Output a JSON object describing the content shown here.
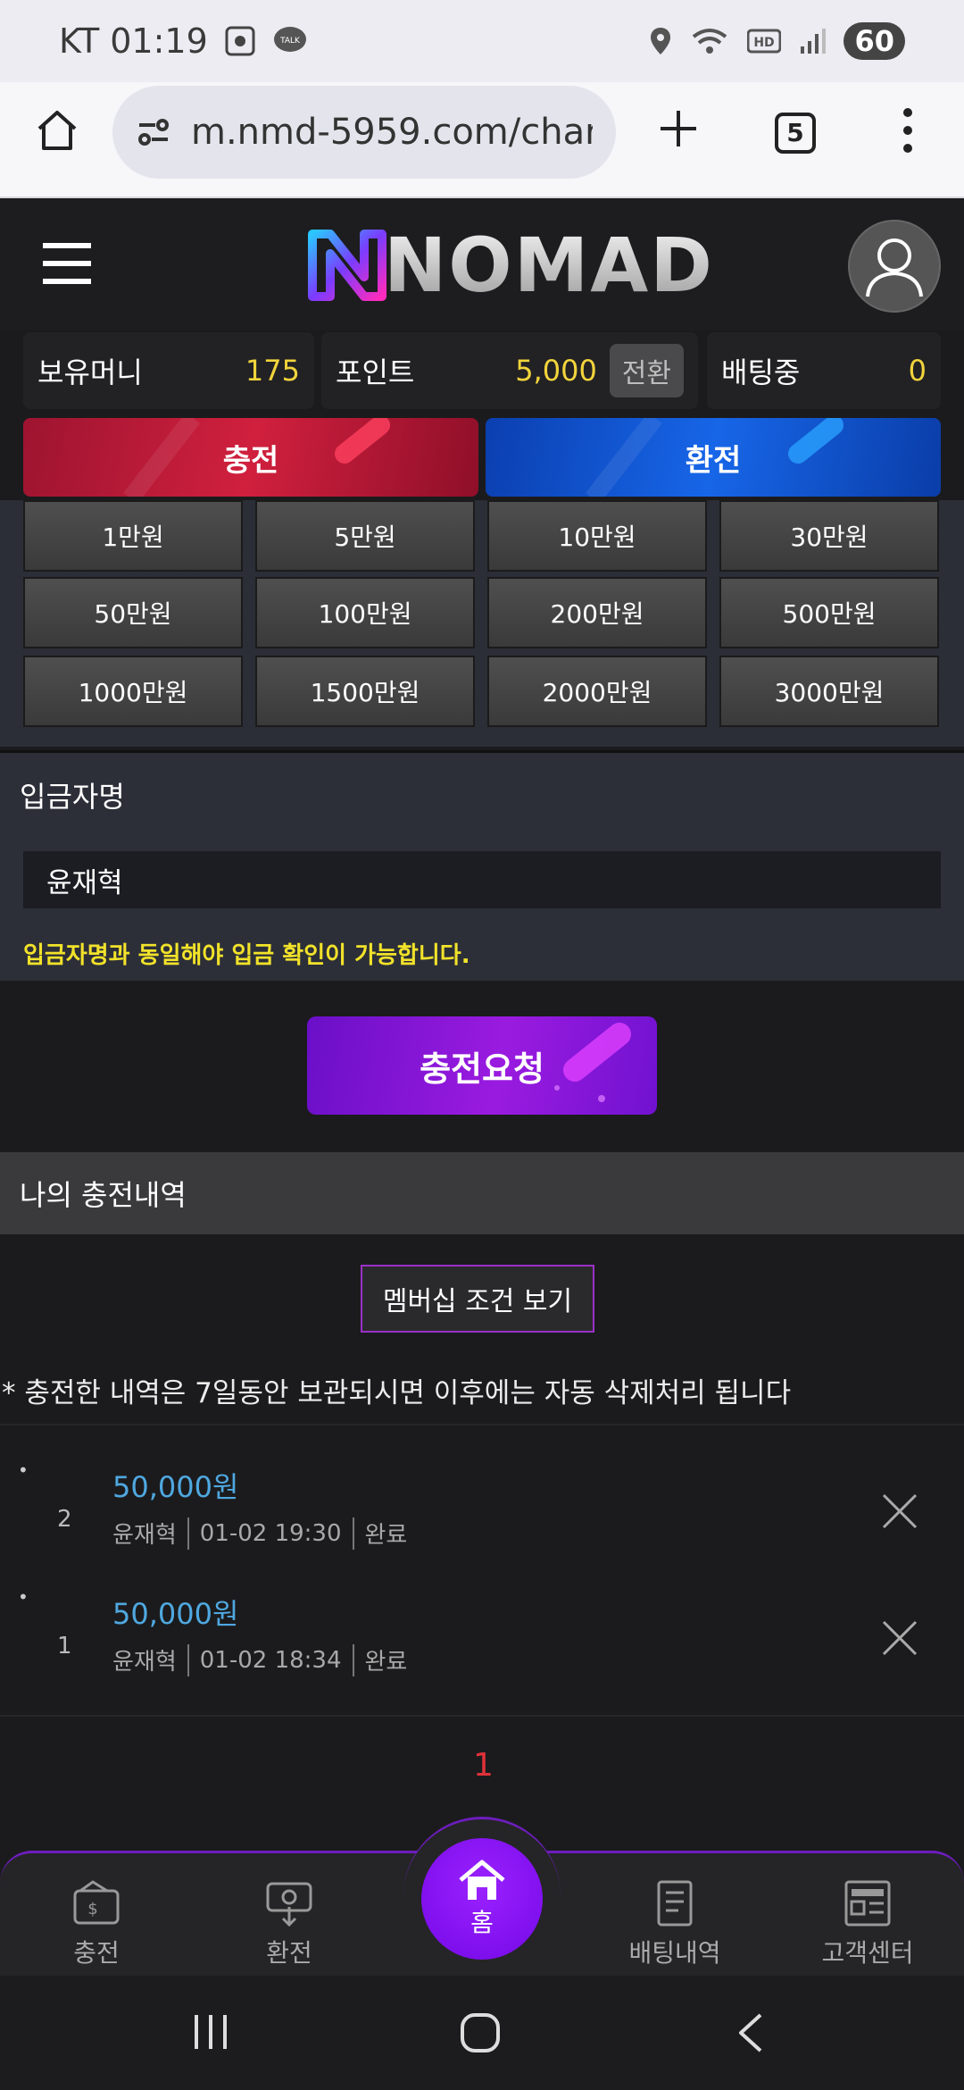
{
  "status_bar": {
    "carrier_time": "KT 01:19",
    "battery": "60"
  },
  "browser": {
    "url": "m.nmd-5959.com/charge",
    "tab_count": "5"
  },
  "header": {
    "logo": "NOMAD"
  },
  "balances": {
    "money_label": "보유머니",
    "money_value": "175",
    "point_label": "포인트",
    "point_value": "5,000",
    "convert_label": "전환",
    "betting_label": "배팅중",
    "betting_value": "0"
  },
  "tabs": {
    "charge": "충전",
    "exchange": "환전"
  },
  "amounts": [
    "1만원",
    "5만원",
    "10만원",
    "30만원",
    "50만원",
    "100만원",
    "200만원",
    "500만원",
    "1000만원",
    "1500만원",
    "2000만원",
    "3000만원"
  ],
  "depositor": {
    "label": "입금자명",
    "value": "윤재혁",
    "notice": "입금자명과 동일해야 입금 확인이 가능합니다."
  },
  "request_button": "충전요청",
  "history": {
    "title": "나의 충전내역",
    "membership_button": "멤버십 조건 보기",
    "retention_note": "* 충전한 내역은 7일동안 보관되시면 이후에는 자동 삭제처리 됩니다",
    "items": [
      {
        "num": "2",
        "amount": "50,000원",
        "name": "윤재혁",
        "datetime": "01-02 19:30",
        "status": "완료"
      },
      {
        "num": "1",
        "amount": "50,000원",
        "name": "윤재혁",
        "datetime": "01-02 18:34",
        "status": "완료"
      }
    ],
    "page": "1"
  },
  "bottom_nav": {
    "charge": "충전",
    "exchange": "환전",
    "home": "홈",
    "bet_history": "배팅내역",
    "support": "고객센터"
  },
  "colors": {
    "accent_yellow": "#f2d43c",
    "charge_red": "#d0203e",
    "exchange_blue": "#1766e8",
    "purple": "#9a1be0",
    "amount_blue": "#4fa8e0",
    "page_red": "#e0323a"
  }
}
